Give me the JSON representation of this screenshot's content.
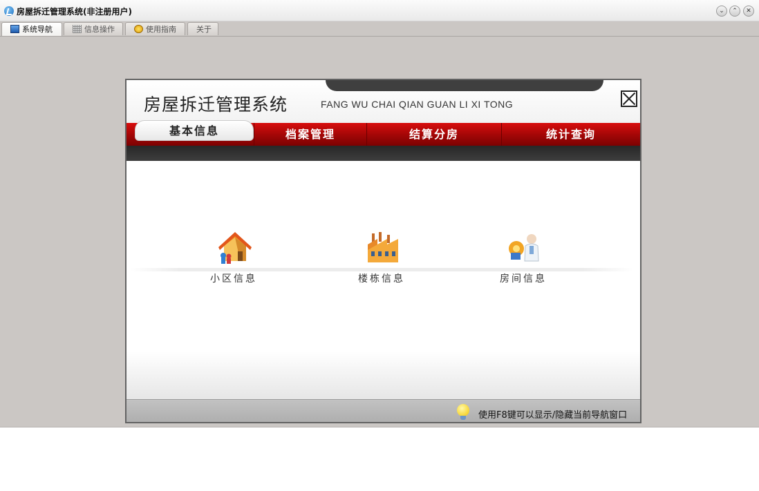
{
  "window": {
    "title": "房屋拆迁管理系统(非注册用户)",
    "controls": [
      "⌄",
      "⌃",
      "✕"
    ]
  },
  "tabs": [
    {
      "label": "系统导航",
      "icon": "monitor-icon",
      "active": true
    },
    {
      "label": "信息操作",
      "icon": "grid-icon",
      "active": false
    },
    {
      "label": "使用指南",
      "icon": "guide-icon",
      "active": false
    },
    {
      "label": "关于",
      "icon": "",
      "active": false
    }
  ],
  "panel": {
    "title": "房屋拆迁管理系统",
    "subtitle": "FANG WU CHAI QIAN GUAN LI XI TONG",
    "nav": [
      {
        "label": "基本信息",
        "active": true
      },
      {
        "label": "档案管理",
        "active": false
      },
      {
        "label": "结算分房",
        "active": false
      },
      {
        "label": "统计查询",
        "active": false
      }
    ],
    "items": [
      {
        "label": "小区信息",
        "icon": "house-icon"
      },
      {
        "label": "楼栋信息",
        "icon": "factory-icon"
      },
      {
        "label": "房间信息",
        "icon": "worker-icon"
      }
    ],
    "hint": "使用F8键可以显示/隐藏当前导航窗口"
  },
  "colors": {
    "nav_red": "#b00707",
    "window_bg": "#cbc7c4",
    "panel_border": "#626262"
  }
}
